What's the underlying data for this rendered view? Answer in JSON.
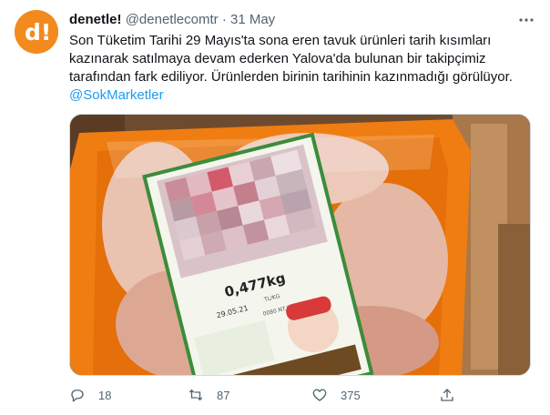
{
  "tweet": {
    "display_name": "denetle!",
    "handle": "@denetlecomtr",
    "separator": "·",
    "date": "31 May",
    "avatar_text": "d!",
    "text": "Son Tüketim Tarihi 29 Mayıs'ta sona eren tavuk ürünleri tarih kısımları kazınarak satılmaya devam ederken Yalova'da bulunan bir takipçimiz tarafından fark ediliyor. Ürünlerden birinin tarihinin kazınmadığı görülüyor.",
    "mention": "@SokMarketler",
    "accent_color": "#1d9bf0",
    "brand_color": "#f28a1e"
  },
  "media": {
    "label_weight": "0,477kg",
    "label_date": "29.05.21",
    "label_small": "TL/KG",
    "label_code": "0080 NT.ST"
  },
  "actions": {
    "replies": "18",
    "retweets": "87",
    "likes": "375",
    "icons": [
      "reply-icon",
      "retweet-icon",
      "like-icon",
      "share-icon"
    ]
  }
}
